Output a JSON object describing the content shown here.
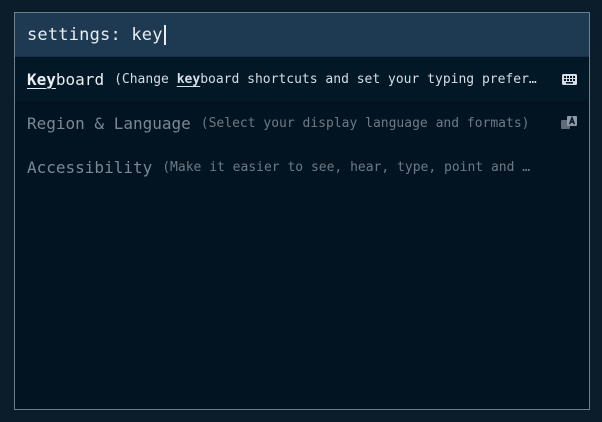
{
  "search": {
    "query": "settings: key"
  },
  "results": [
    {
      "title_match": "Key",
      "title_rest": "board",
      "desc_open": "(Change ",
      "desc_match": "key",
      "desc_rest": "board shortcuts and set your typing prefer…",
      "icon": "keyboard-icon",
      "selected": true
    },
    {
      "title": "Region & Language",
      "desc": "(Select your display language and formats)",
      "icon": "language-icon",
      "selected": false
    },
    {
      "title": "Accessibility",
      "desc": "(Make it easier to see, hear, type, point and …",
      "icon": "",
      "selected": false
    }
  ],
  "colors": {
    "page_background": "#0b1c2b",
    "panel_background": "#021422",
    "search_background": "#1d3a52",
    "text_primary": "#e8edf2",
    "text_dim": "#7b8894"
  }
}
